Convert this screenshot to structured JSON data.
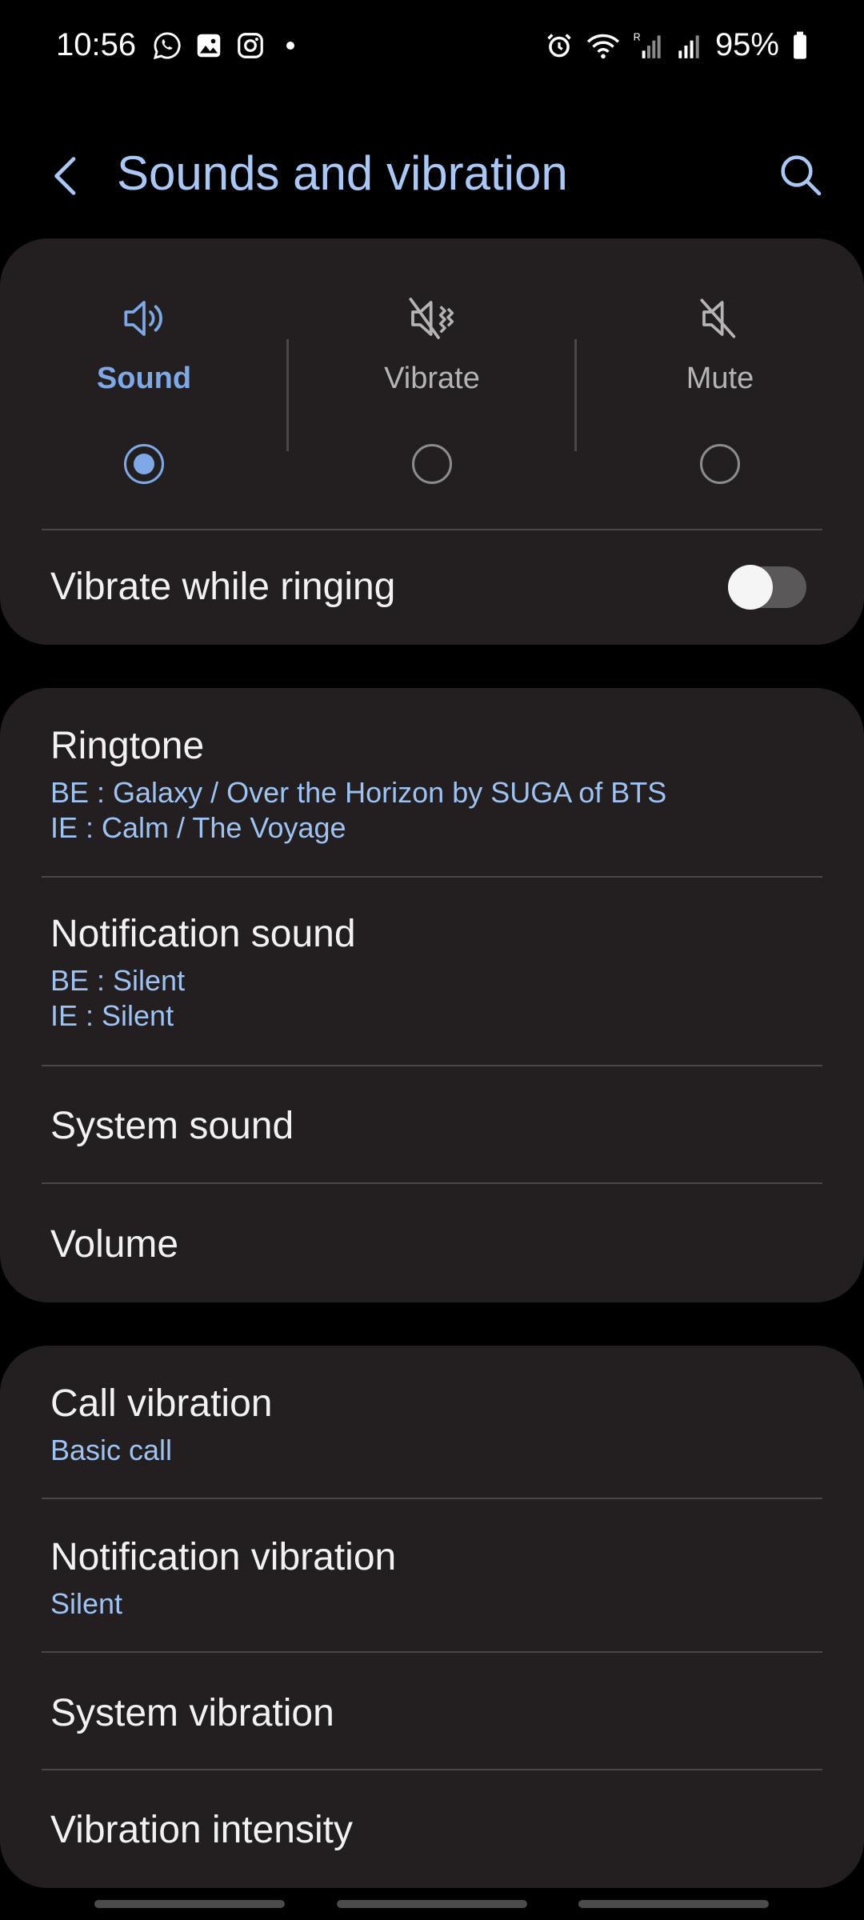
{
  "status_bar": {
    "time": "10:56",
    "battery": "95%",
    "left_icons": [
      "whatsapp-icon",
      "gallery-icon",
      "instagram-icon",
      "dot-icon"
    ],
    "right_icons": [
      "alarm-icon",
      "wifi-icon",
      "signal-roaming-icon",
      "signal-icon",
      "battery-icon"
    ]
  },
  "header": {
    "title": "Sounds and vibration"
  },
  "sound_modes": {
    "items": [
      {
        "label": "Sound",
        "icon": "speaker-icon",
        "selected": true
      },
      {
        "label": "Vibrate",
        "icon": "vibrate-icon",
        "selected": false
      },
      {
        "label": "Mute",
        "icon": "mute-icon",
        "selected": false
      }
    ],
    "vibrate_while_ringing": {
      "label": "Vibrate while ringing",
      "enabled": false
    }
  },
  "sound_settings": [
    {
      "title": "Ringtone",
      "subtitle": [
        "BE : Galaxy / Over the Horizon by SUGA of BTS",
        "IE : Calm / The Voyage"
      ]
    },
    {
      "title": "Notification sound",
      "subtitle": [
        "BE : Silent",
        "IE : Silent"
      ]
    },
    {
      "title": "System sound",
      "subtitle": []
    },
    {
      "title": "Volume",
      "subtitle": []
    }
  ],
  "vibration_settings": [
    {
      "title": "Call vibration",
      "subtitle": [
        "Basic call"
      ]
    },
    {
      "title": "Notification vibration",
      "subtitle": [
        "Silent"
      ]
    },
    {
      "title": "System vibration",
      "subtitle": []
    },
    {
      "title": "Vibration intensity",
      "subtitle": []
    }
  ],
  "colors": {
    "accent": "#7fa9e6",
    "title": "#a9c8f5",
    "subtitle": "#9ec2f2",
    "card": "#231f20",
    "background": "#000000"
  }
}
